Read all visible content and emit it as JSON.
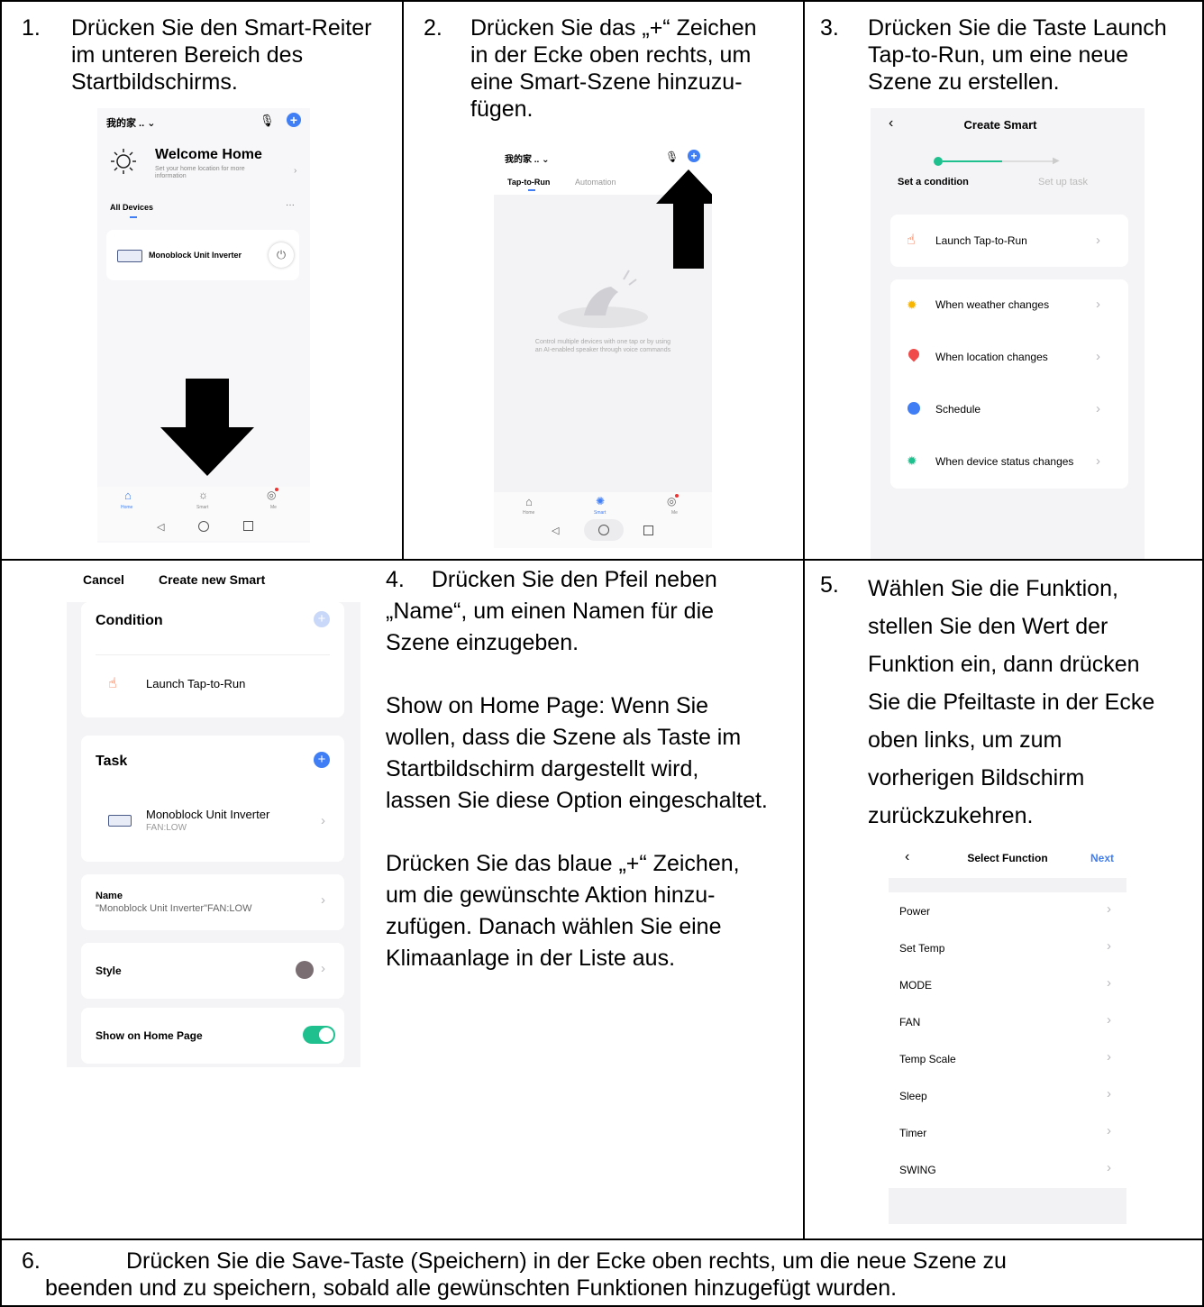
{
  "steps": {
    "s1": {
      "num": "1.",
      "lines": [
        "Drücken Sie den Smart-Reiter",
        "im unteren Bereich des",
        "Startbildschirms."
      ]
    },
    "s2": {
      "num": "2.",
      "lines": [
        "Drücken Sie das „+“ Zeichen",
        "in der Ecke oben rechts, um",
        "eine Smart-Szene hinzuzu-",
        "fügen."
      ]
    },
    "s3": {
      "num": "3.",
      "lines": [
        "Drücken Sie die Taste Launch",
        "Tap-to-Run, um eine neue",
        "Szene zu erstellen."
      ]
    },
    "s4": {
      "num": "4.",
      "lines": [
        "Drücken Sie den Pfeil neben",
        "„Name“, um einen Namen für die",
        "Szene einzugeben."
      ],
      "p2": [
        "Show on Home Page: Wenn Sie",
        "wollen, dass die Szene als Taste im",
        "Startbildschirm dargestellt wird,",
        "lassen Sie diese Option eingeschaltet."
      ],
      "p3": [
        "Drücken Sie das blaue „+“ Zeichen,",
        "um die gewünschte Aktion hinzu-",
        "zufügen. Danach wählen Sie eine",
        "Klimaanlage in der Liste aus."
      ]
    },
    "s5": {
      "num": "5.",
      "lines": [
        "Wählen Sie die Funktion,",
        "stellen Sie den Wert der",
        "Funktion ein, dann drücken",
        "Sie die Pfeiltaste in der Ecke",
        "oben links, um zum",
        "vorherigen Bildschirm",
        "zurückzukehren."
      ]
    },
    "s6": {
      "num": "6.",
      "lines": [
        "Drücken Sie die Save-Taste (Speichern) in der Ecke oben rechts, um die neue Szene zu",
        "beenden und zu speichern, sobald alle gewünschten Funktionen hinzugefügt wurden."
      ]
    }
  },
  "shot1": {
    "home_name": "我的家 .. ⌄",
    "welcome": "Welcome Home",
    "welcome_sub1": "Set your home location for more",
    "welcome_sub2": "information",
    "all_devices": "All Devices",
    "dots": "···",
    "device": "Monoblock Unit Inverter",
    "tabs": [
      "Home",
      "Smart",
      "Me"
    ]
  },
  "shot2": {
    "home_name": "我的家 .. ⌄",
    "tab_active": "Tap-to-Run",
    "tab_other": "Automation",
    "hint1": "Control multiple devices with one tap or by using",
    "hint2": "an AI-enabled speaker through voice commands",
    "tabs": [
      "Home",
      "Smart",
      "Me"
    ]
  },
  "shot3": {
    "title": "Create Smart",
    "step1": "Set a condition",
    "step2": "Set up task",
    "items": [
      "Launch Tap-to-Run",
      "When weather changes",
      "When location changes",
      "Schedule",
      "When device status changes"
    ]
  },
  "shot4": {
    "cancel": "Cancel",
    "title": "Create new Smart",
    "condition": "Condition",
    "launch": "Launch Tap-to-Run",
    "task": "Task",
    "device": "Monoblock Unit Inverter",
    "device_sub": "FAN:LOW",
    "name_label": "Name",
    "name_value": "\"Monoblock Unit Inverter\"FAN:LOW",
    "style": "Style",
    "show_home": "Show on Home Page"
  },
  "shot5": {
    "title": "Select Function",
    "next": "Next",
    "items": [
      "Power",
      "Set Temp",
      "MODE",
      "FAN",
      "Temp Scale",
      "Sleep",
      "Timer",
      "SWING"
    ]
  },
  "colors": {
    "blue": "#3f7ef5",
    "green": "#1fc08e",
    "orange": "#f25a2c",
    "arrow": "#000000"
  }
}
